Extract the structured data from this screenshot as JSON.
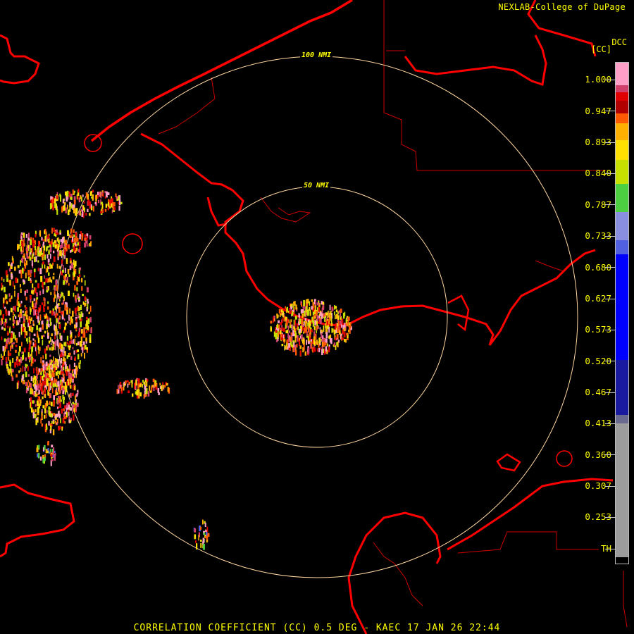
{
  "header": {
    "credit": "NEXLAB-College of DuPage"
  },
  "legend": {
    "product_code": "DCC",
    "units": "[CC]",
    "labels": [
      "1.000",
      "0.947",
      "0.893",
      "0.840",
      "0.787",
      "0.733",
      "0.680",
      "0.627",
      "0.573",
      "0.520",
      "0.467",
      "0.413",
      "0.360",
      "0.307",
      "0.253",
      "TH"
    ]
  },
  "rings": [
    {
      "label": "100 NMI"
    },
    {
      "label": "50 NMI"
    }
  ],
  "footer": {
    "caption": "CORRELATION COEFFICIENT (CC) 0.5 DEG - KAEC 17 JAN 26 22:44"
  },
  "colors": {
    "coast": "#ff0000",
    "boundary": "#cc0000",
    "ring": "#ffd7a0",
    "text": "#ffff00"
  }
}
